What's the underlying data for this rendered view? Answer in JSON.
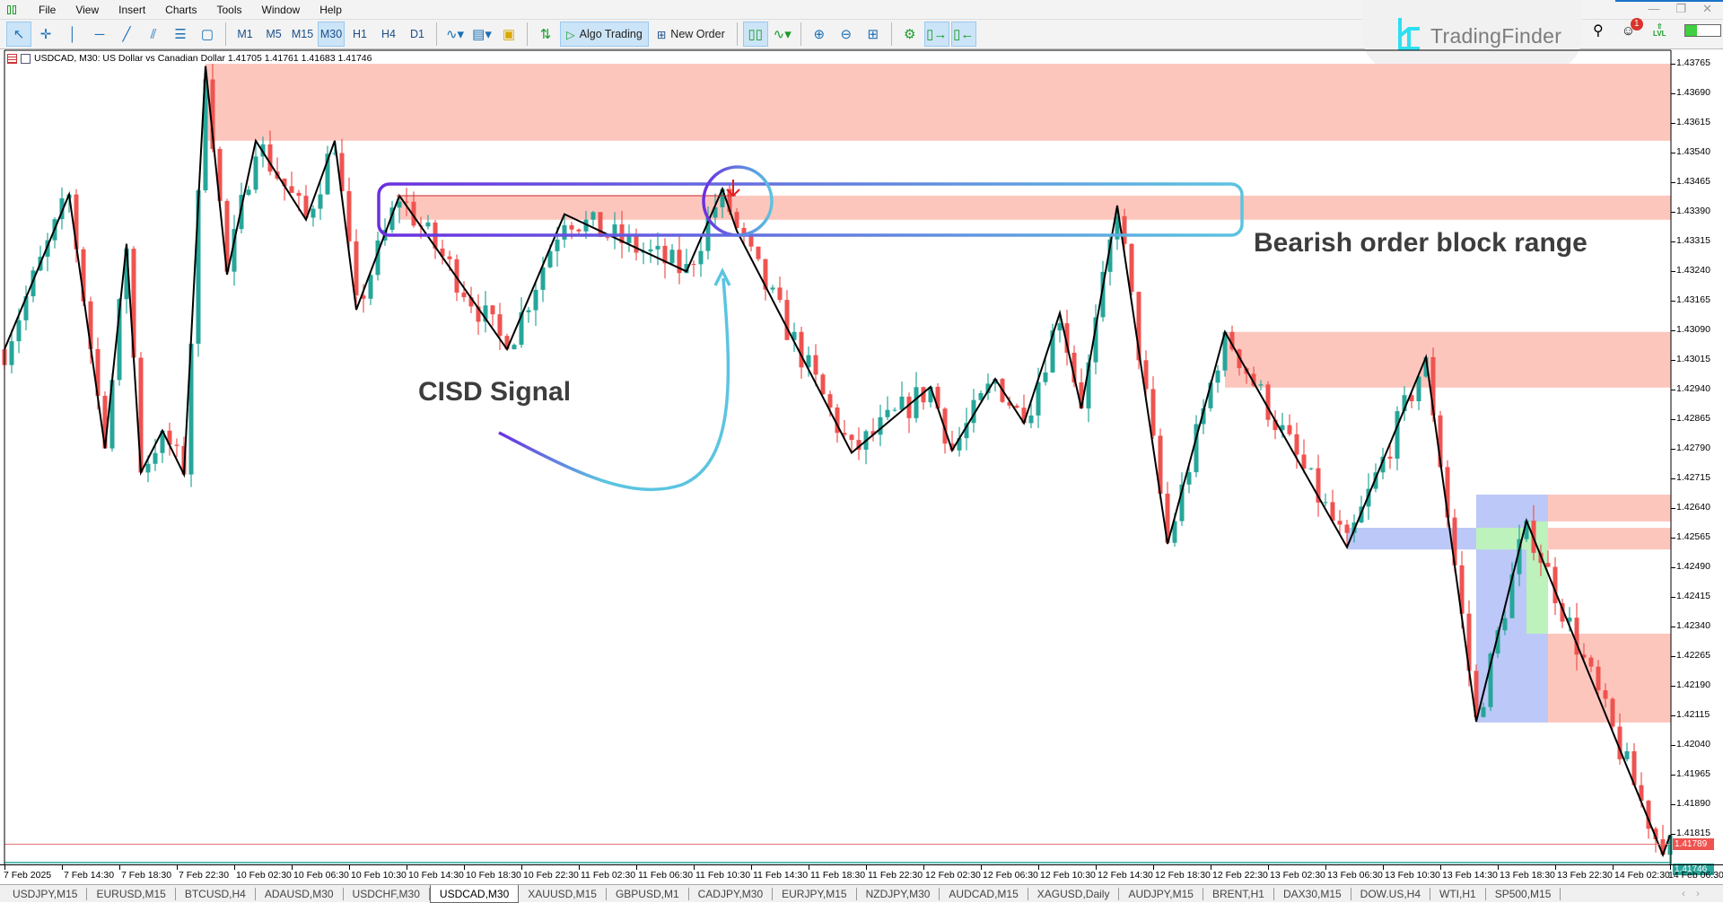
{
  "menu": {
    "items": [
      "File",
      "View",
      "Insert",
      "Charts",
      "Tools",
      "Window",
      "Help"
    ]
  },
  "toolbar": {
    "tools": [
      {
        "icon": "cursor-icon",
        "active": true
      },
      {
        "icon": "crosshair-icon"
      },
      {
        "icon": "vertical-line-icon"
      },
      {
        "icon": "horizontal-line-icon"
      },
      {
        "icon": "trendline-icon"
      },
      {
        "icon": "channel-icon"
      },
      {
        "icon": "fibonacci-icon"
      },
      {
        "icon": "shapes-icon"
      }
    ],
    "timeframes": [
      {
        "label": "M1"
      },
      {
        "label": "M5"
      },
      {
        "label": "M15"
      },
      {
        "label": "M30",
        "active": true
      },
      {
        "label": "H1"
      },
      {
        "label": "H4"
      },
      {
        "label": "D1"
      }
    ],
    "algo_trading": "Algo Trading",
    "new_order": "New Order"
  },
  "right_icons": {
    "notifications_count": "1",
    "level_label": "LVL",
    "level_fill": 0.35
  },
  "logo": {
    "text": "TradingFinder"
  },
  "chart": {
    "title": "USDCAD, M30:  US Dollar vs Canadian Dollar  1.41705 1.41761 1.41683 1.41746",
    "bid_price": "1.41789",
    "last_price": "1.41746",
    "bid_value": 1.41789,
    "last_value": 1.41746,
    "colors": {
      "bull": "#26a69a",
      "bear": "#ef5350",
      "zone_pink": "#fdc6bd",
      "zone_blue": "#bcc8f7",
      "zone_green": "#bdf2bd"
    },
    "price_ticks": [
      "1.43765",
      "1.43690",
      "1.43615",
      "1.43540",
      "1.43465",
      "1.43390",
      "1.43315",
      "1.43240",
      "1.43165",
      "1.43090",
      "1.43015",
      "1.42940",
      "1.42865",
      "1.42790",
      "1.42715",
      "1.42640",
      "1.42565",
      "1.42490",
      "1.42415",
      "1.42340",
      "1.42265",
      "1.42190",
      "1.42115",
      "1.42040",
      "1.41965",
      "1.41890",
      "1.41815"
    ],
    "time_ticks": [
      "7 Feb 2025",
      "7 Feb 14:30",
      "7 Feb 18:30",
      "7 Feb 22:30",
      "10 Feb 02:30",
      "10 Feb 06:30",
      "10 Feb 10:30",
      "10 Feb 14:30",
      "10 Feb 18:30",
      "10 Feb 22:30",
      "11 Feb 02:30",
      "11 Feb 06:30",
      "11 Feb 10:30",
      "11 Feb 14:30",
      "11 Feb 18:30",
      "11 Feb 22:30",
      "12 Feb 02:30",
      "12 Feb 06:30",
      "12 Feb 10:30",
      "12 Feb 14:30",
      "12 Feb 18:30",
      "12 Feb 22:30",
      "13 Feb 02:30",
      "13 Feb 06:30",
      "13 Feb 10:30",
      "13 Feb 14:30",
      "13 Feb 18:30",
      "13 Feb 22:30",
      "14 Feb 02:30",
      "14 Feb 06:30"
    ],
    "zigzag": [
      {
        "t": "7 Feb 10:30",
        "p": 1.43042
      },
      {
        "t": "7 Feb 15:00",
        "p": 1.43434
      },
      {
        "t": "7 Feb 17:30",
        "p": 1.42791
      },
      {
        "t": "7 Feb 19:00",
        "p": 1.43309
      },
      {
        "t": "7 Feb 20:00",
        "p": 1.4273
      },
      {
        "t": "7 Feb 21:30",
        "p": 1.42836
      },
      {
        "t": "7 Feb 23:00",
        "p": 1.42725
      },
      {
        "t": "10 Feb 00:30",
        "p": 1.43759
      },
      {
        "t": "10 Feb 02:00",
        "p": 1.43231
      },
      {
        "t": "10 Feb 04:00",
        "p": 1.4357
      },
      {
        "t": "10 Feb 07:30",
        "p": 1.4337
      },
      {
        "t": "10 Feb 09:30",
        "p": 1.4357
      },
      {
        "t": "10 Feb 11:00",
        "p": 1.43142
      },
      {
        "t": "10 Feb 14:00",
        "p": 1.43431
      },
      {
        "t": "10 Feb 21:30",
        "p": 1.43042
      },
      {
        "t": "11 Feb 01:30",
        "p": 1.43384
      },
      {
        "t": "11 Feb 10:00",
        "p": 1.43239
      },
      {
        "t": "11 Feb 12:30",
        "p": 1.43448
      },
      {
        "t": "11 Feb 13:30",
        "p": 1.43342
      },
      {
        "t": "11 Feb 21:30",
        "p": 1.4278
      },
      {
        "t": "12 Feb 03:00",
        "p": 1.42947
      },
      {
        "t": "12 Feb 04:30",
        "p": 1.42786
      },
      {
        "t": "12 Feb 07:30",
        "p": 1.42967
      },
      {
        "t": "12 Feb 09:30",
        "p": 1.42855
      },
      {
        "t": "12 Feb 12:00",
        "p": 1.43134
      },
      {
        "t": "12 Feb 13:30",
        "p": 1.42892
      },
      {
        "t": "12 Feb 16:00",
        "p": 1.43406
      },
      {
        "t": "12 Feb 19:30",
        "p": 1.42549
      },
      {
        "t": "12 Feb 23:30",
        "p": 1.43086
      },
      {
        "t": "13 Feb 08:00",
        "p": 1.42541
      },
      {
        "t": "13 Feb 13:30",
        "p": 1.43022
      },
      {
        "t": "13 Feb 17:00",
        "p": 1.42099
      },
      {
        "t": "13 Feb 20:30",
        "p": 1.42608
      },
      {
        "t": "14 Feb 06:00",
        "p": 1.41762
      },
      {
        "t": "14 Feb 06:30",
        "p": 1.41812
      }
    ],
    "zones": [
      {
        "kind": "pink",
        "from": "10 Feb 00:30",
        "to": "end",
        "top": 1.43765,
        "bottom": 1.4357
      },
      {
        "kind": "pink",
        "from": "10 Feb 14:00",
        "to": "end",
        "top": 1.43431,
        "bottom": 1.4337
      },
      {
        "kind": "pink",
        "from": "12 Feb 23:30",
        "to": "end",
        "top": 1.43086,
        "bottom": 1.42945
      },
      {
        "kind": "blue",
        "from": "13 Feb 08:00",
        "to": "13 Feb 17:00",
        "top": 1.4259,
        "bottom": 1.42535
      },
      {
        "kind": "blue",
        "from": "13 Feb 17:00",
        "to": "13 Feb 22:00",
        "top": 1.42674,
        "bottom": 1.42097
      },
      {
        "kind": "green",
        "from": "13 Feb 20:30",
        "to": "13 Feb 22:00",
        "top": 1.42606,
        "bottom": 1.42322
      },
      {
        "kind": "green",
        "from": "13 Feb 17:00",
        "to": "13 Feb 22:00",
        "top": 1.4259,
        "bottom": 1.42535
      },
      {
        "kind": "pink",
        "from": "13 Feb 22:00",
        "to": "end",
        "top": 1.42674,
        "bottom": 1.42606
      },
      {
        "kind": "pink",
        "from": "13 Feb 22:00",
        "to": "end",
        "top": 1.4259,
        "bottom": 1.42535
      },
      {
        "kind": "pink",
        "from": "13 Feb 22:00",
        "to": "end",
        "top": 1.42322,
        "bottom": 1.42097
      }
    ],
    "annotations": {
      "cisd": "CISD Signal",
      "ob_range": "Bearish order block range"
    }
  },
  "tabs": [
    {
      "label": "USDJPY,M15"
    },
    {
      "label": "EURUSD,M15"
    },
    {
      "label": "BTCUSD,H4"
    },
    {
      "label": "ADAUSD,M30"
    },
    {
      "label": "USDCHF,M30"
    },
    {
      "label": "USDCAD,M30",
      "active": true
    },
    {
      "label": "XAUUSD,M15"
    },
    {
      "label": "GBPUSD,M1"
    },
    {
      "label": "CADJPY,M30"
    },
    {
      "label": "EURJPY,M15"
    },
    {
      "label": "NZDJPY,M30"
    },
    {
      "label": "AUDCAD,M15"
    },
    {
      "label": "XAGUSD,Daily"
    },
    {
      "label": "AUDJPY,M15"
    },
    {
      "label": "BRENT,H1"
    },
    {
      "label": "DAX30,M15"
    },
    {
      "label": "DOW.US,H4"
    },
    {
      "label": "WTI,H1"
    },
    {
      "label": "SP500,M15"
    }
  ]
}
